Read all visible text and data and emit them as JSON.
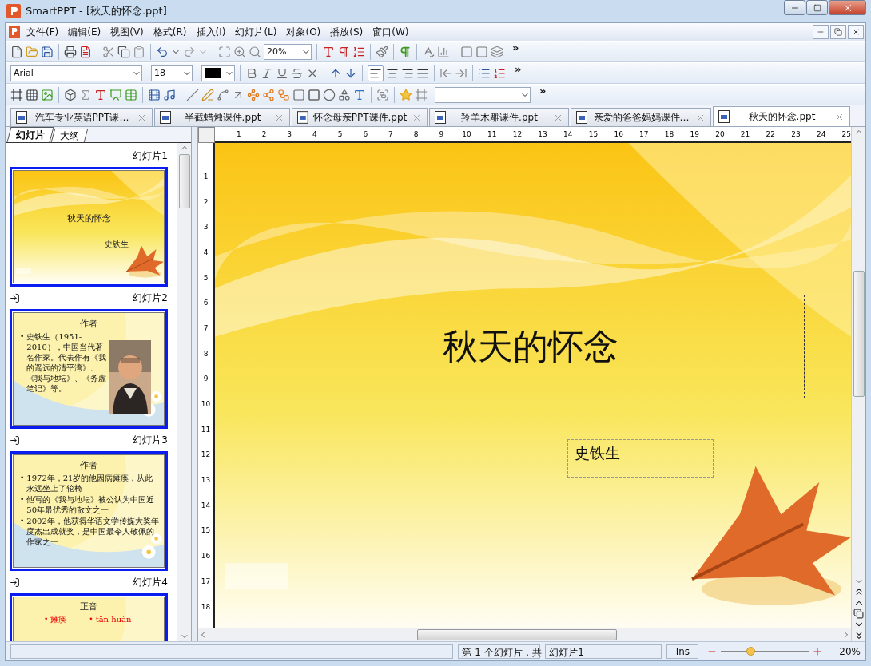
{
  "window": {
    "title": "SmartPPT - [秋天的怀念.ppt]"
  },
  "menu": [
    "文件(F)",
    "编辑(E)",
    "视图(V)",
    "格式(R)",
    "插入(I)",
    "幻灯片(L)",
    "对象(O)",
    "播放(S)",
    "窗口(W)"
  ],
  "toolbars": {
    "standard": {
      "zoom": "20%",
      "overflow": "»"
    },
    "formatting": {
      "font": "Arial",
      "size": "18",
      "overflow": "»"
    },
    "drawing": {
      "overflow": "»"
    }
  },
  "document_tabs": [
    {
      "label": "汽车专业英语PPT课…",
      "selected": false
    },
    {
      "label": "半截蜡烛课件.ppt",
      "selected": false
    },
    {
      "label": "怀念母亲PPT课件.ppt",
      "selected": false
    },
    {
      "label": "羚羊木雕课件.ppt",
      "selected": false
    },
    {
      "label": "亲爱的爸爸妈妈课件…",
      "selected": false
    },
    {
      "label": "秋天的怀念.ppt",
      "selected": true
    }
  ],
  "panel_tabs": [
    {
      "label": "幻灯片",
      "selected": true
    },
    {
      "label": "大纲",
      "selected": false
    }
  ],
  "slides": [
    {
      "label": "幻灯片1",
      "kind": "title",
      "transition": false,
      "title": "秋天的怀念",
      "subtitle": "史铁生"
    },
    {
      "label": "幻灯片2",
      "transition": true,
      "title": "作者",
      "bullet_marker": "•",
      "bullets": [
        "史铁生（1951-2010），中国当代著名作家。代表作有《我的遥远的清平湾》、《我与地坛》、《务虚笔记》等。"
      ]
    },
    {
      "label": "幻灯片3",
      "kind": "bullets",
      "transition": true,
      "title": "作者",
      "bullet_marker": "•",
      "bullets": [
        "1972年，21岁的他因病瘫痪，从此永远坐上了轮椅",
        "他写的《我与地坛》被公认为中国近50年最优秀的散文之一",
        "2002年，他获得华语文学传媒大奖年度杰出成就奖，是中国最令人敬佩的作家之一"
      ]
    },
    {
      "label": "幻灯片4",
      "kind": "columns",
      "transition": true,
      "title": "正音",
      "bullet_marker": "•",
      "bullets": [
        "瘫痪",
        "tān huàn"
      ]
    }
  ],
  "ruler": {
    "horizontal": [
      "1",
      "2",
      "3",
      "4",
      "5",
      "6",
      "7",
      "8",
      "9",
      "10",
      "11",
      "12",
      "13",
      "14",
      "15",
      "16",
      "17",
      "18",
      "19",
      "20",
      "21",
      "22",
      "23",
      "24",
      "25"
    ],
    "vertical": [
      "1",
      "2",
      "3",
      "4",
      "5",
      "6",
      "7",
      "8",
      "9",
      "10",
      "11",
      "12",
      "13",
      "14",
      "15",
      "16",
      "17",
      "18"
    ]
  },
  "slide": {
    "title": "秋天的怀念",
    "subtitle": "史铁生"
  },
  "status_bar": {
    "position": "第 1 个幻灯片，共",
    "slide_name": "幻灯片1",
    "mode": "Ins",
    "zoom_slider": {
      "level": 0.34
    },
    "zoom": "20%"
  }
}
